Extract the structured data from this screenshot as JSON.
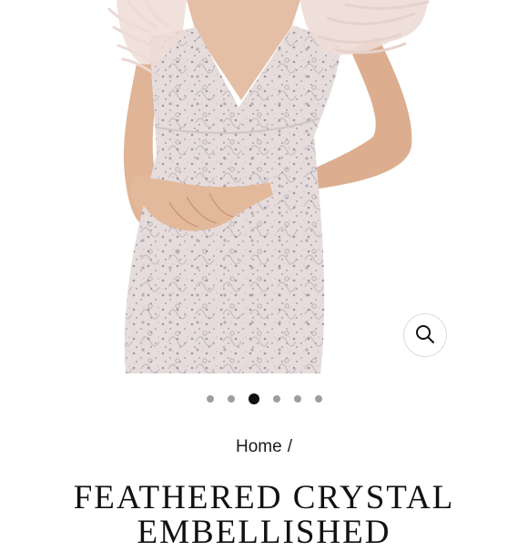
{
  "gallery": {
    "slides": [
      {
        "active": false
      },
      {
        "active": false
      },
      {
        "active": true
      },
      {
        "active": false
      },
      {
        "active": false
      },
      {
        "active": false
      }
    ],
    "zoom_icon": "search-icon"
  },
  "breadcrumb": {
    "home": "Home",
    "separator": "/"
  },
  "product": {
    "title_line1": "FEATHERED CRYSTAL",
    "title_line2": "EMBELLISHED"
  },
  "colors": {
    "dress": "#e6dcdc",
    "feathers": "#eddcd6",
    "skin": "#e0b496",
    "active_dot": "#111111",
    "inactive_dot": "#9e9e9e"
  }
}
